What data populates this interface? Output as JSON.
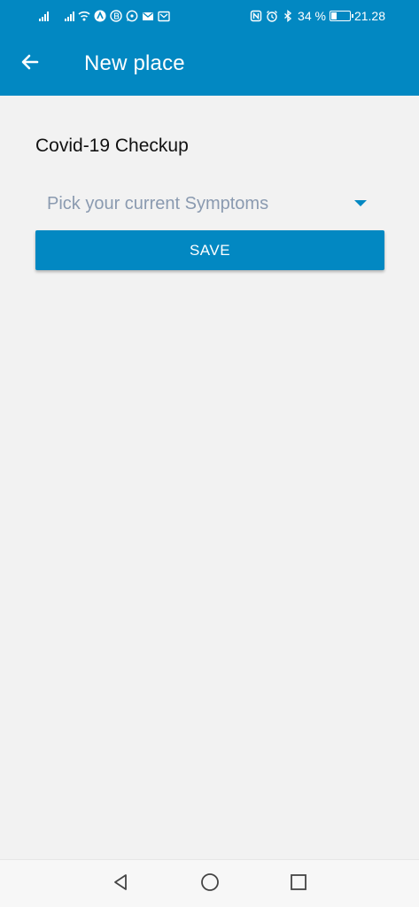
{
  "status_bar": {
    "battery_percent": "34 %",
    "time": "21.28",
    "battery_level": 0.34,
    "icons_left": [
      "signal-icon",
      "signal-icon",
      "wifi-icon",
      "app-a-icon",
      "app-b-icon",
      "whatsapp-icon",
      "mail-icon",
      "mail-icon"
    ],
    "icons_right": [
      "nfc-icon",
      "alarm-icon",
      "bluetooth-icon",
      "battery-icon"
    ]
  },
  "app_bar": {
    "title": "New place",
    "back_icon": "arrow-left-icon",
    "color": "#0288c2"
  },
  "form": {
    "section_title": "Covid-19 Checkup",
    "symptoms_placeholder": "Pick your current  Symptoms",
    "save_label": "SAVE"
  },
  "nav_bar": {
    "items": [
      "back-triangle-icon",
      "home-circle-icon",
      "recents-square-icon"
    ]
  }
}
